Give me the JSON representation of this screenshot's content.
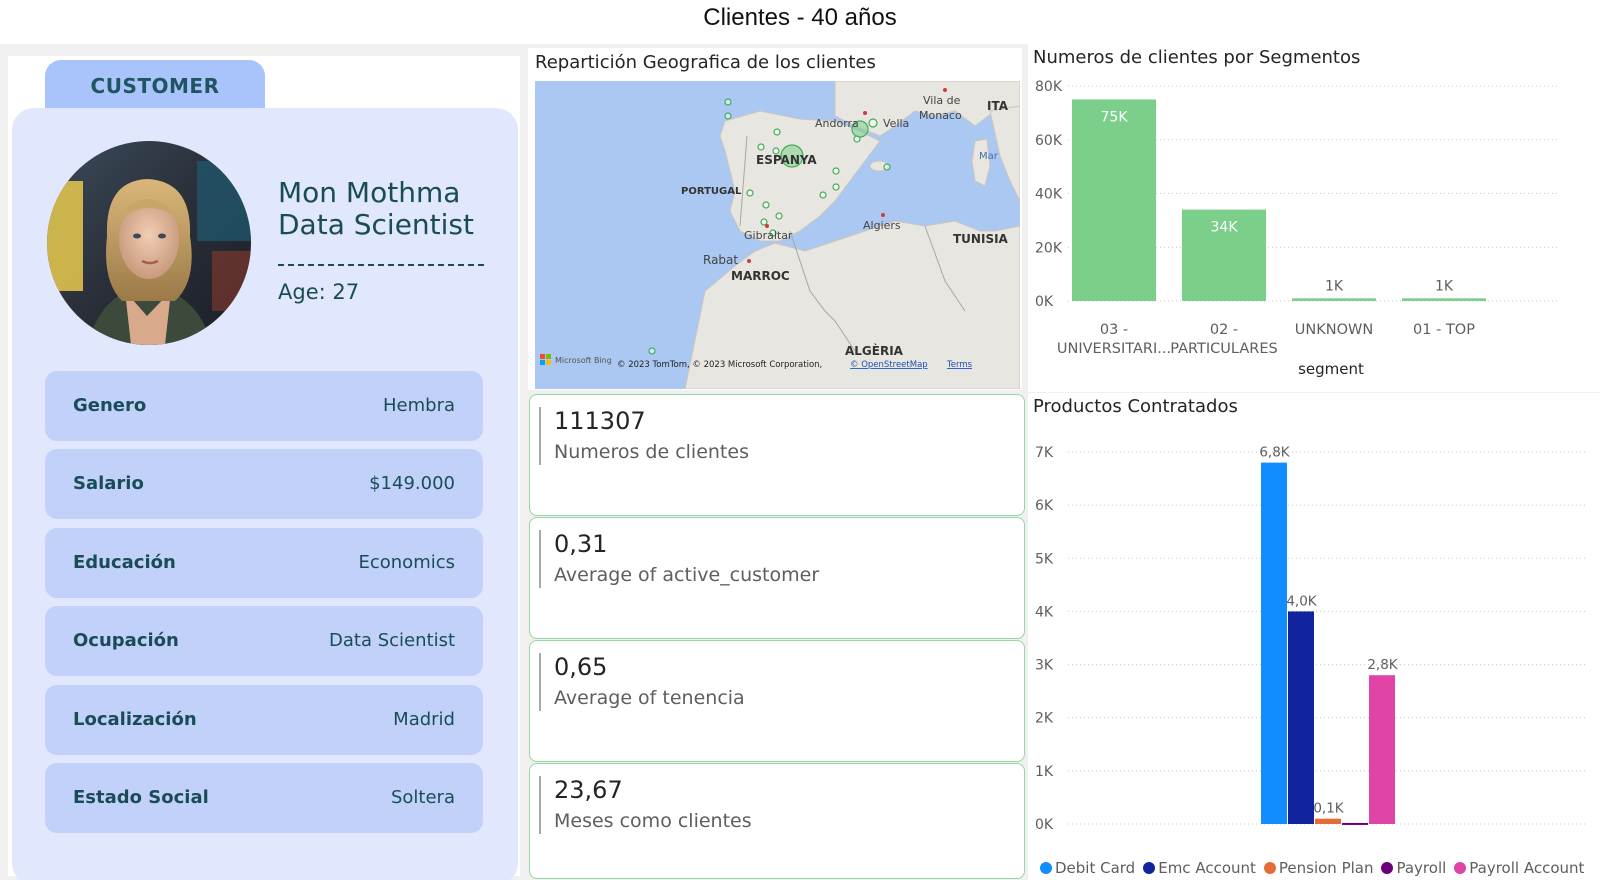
{
  "header": {
    "title": "Clientes - 40 años"
  },
  "customer": {
    "tab_label": "CUSTOMER",
    "name": "Mon Mothma",
    "role": "Data Scientist",
    "age": "Age: 27",
    "fields": [
      {
        "key": "Genero",
        "value": "Hembra"
      },
      {
        "key": "Salario",
        "value": "$149.000"
      },
      {
        "key": "Educación",
        "value": "Economics"
      },
      {
        "key": "Ocupación",
        "value": "Data Scientist"
      },
      {
        "key": "Localización",
        "value": "Madrid"
      },
      {
        "key": "Estado Social",
        "value": "Soltera"
      }
    ]
  },
  "map": {
    "title": "Repartición Geografica de los clientes",
    "labels": {
      "espanya": "ESPANYA",
      "portugal": "PORTUGAL",
      "andorra": "Andorra",
      "vella": "Vella",
      "monaco_1": "Vila de",
      "monaco_2": "Monaco",
      "italy": "ITA",
      "mar": "Mar",
      "gibraltar": "Gibraltar",
      "algiers": "Algiers",
      "tunisia": "TUNISIA",
      "rabat": "Rabat",
      "marroc": "MARROC",
      "algeria": "ALGÈRIA"
    },
    "bing": "Microsoft Bing",
    "attribution": "© 2023 TomTom, © 2023 Microsoft Corporation,",
    "osm_link": "© OpenStreetMap",
    "terms_link": "Terms"
  },
  "kpis": [
    {
      "value": "111307",
      "label": "Numeros de clientes"
    },
    {
      "value": "0,31",
      "label": "Average of active_customer"
    },
    {
      "value": "0,65",
      "label": "Average of tenencia"
    },
    {
      "value": "23,67",
      "label": "Meses como clientes"
    }
  ],
  "chart_data": [
    {
      "type": "bar",
      "title": "Numeros de clientes por Segmentos",
      "xlabel": "segment",
      "ylabel": "",
      "categories": [
        "03 - UNIVERSITARI...",
        "02 - PARTICULARES",
        "UNKNOWN",
        "01 - TOP"
      ],
      "category_lines": [
        [
          "03 -",
          "UNIVERSITARI..."
        ],
        [
          "02 -",
          "PARTICULARES"
        ],
        [
          "UNKNOWN"
        ],
        [
          "01 - TOP"
        ]
      ],
      "values": [
        75000,
        34000,
        1000,
        1000
      ],
      "data_labels": [
        "75K",
        "34K",
        "1K",
        "1K"
      ],
      "ylim": [
        0,
        80000
      ],
      "yticks": [
        0,
        20000,
        40000,
        60000,
        80000
      ],
      "ytick_labels": [
        "0K",
        "20K",
        "40K",
        "60K",
        "80K"
      ],
      "color": "#7bcf8b",
      "grid": true
    },
    {
      "type": "bar",
      "title": "Productos Contratados",
      "xlabel": "",
      "ylabel": "",
      "categories": [
        "Debit Card",
        "Emc Account",
        "Pension Plan",
        "Payroll",
        "Payroll Account"
      ],
      "series": [
        {
          "name": "Debit Card",
          "value": 6800,
          "label": "6,8K",
          "color": "#118dff"
        },
        {
          "name": "Emc Account",
          "value": 4000,
          "label": "4,0K",
          "color": "#12239e"
        },
        {
          "name": "Pension Plan",
          "value": 100,
          "label": "0,1K",
          "color": "#e66c37"
        },
        {
          "name": "Payroll",
          "value": 20,
          "label": "",
          "color": "#6b007b"
        },
        {
          "name": "Payroll Account",
          "value": 2800,
          "label": "2,8K",
          "color": "#e044a7"
        }
      ],
      "ylim": [
        0,
        7000
      ],
      "yticks": [
        0,
        1000,
        2000,
        3000,
        4000,
        5000,
        6000,
        7000
      ],
      "ytick_labels": [
        "0K",
        "1K",
        "2K",
        "3K",
        "4K",
        "5K",
        "6K",
        "7K"
      ],
      "legend_position": "bottom",
      "grid": true
    }
  ]
}
